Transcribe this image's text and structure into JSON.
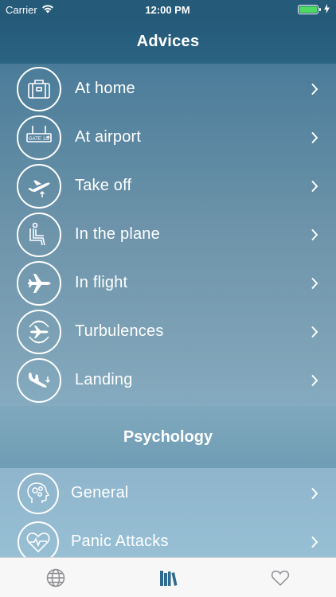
{
  "status_bar": {
    "carrier": "Carrier",
    "time": "12:00 PM",
    "battery_level": 1.0
  },
  "nav": {
    "title": "Advices"
  },
  "advices": [
    {
      "label": "At home",
      "icon": "suitcase-icon"
    },
    {
      "label": "At airport",
      "icon": "gate-sign-icon",
      "icon_text": "GATE 12"
    },
    {
      "label": "Take off",
      "icon": "takeoff-icon"
    },
    {
      "label": "In the plane",
      "icon": "seat-icon"
    },
    {
      "label": "In flight",
      "icon": "airplane-icon"
    },
    {
      "label": "Turbulences",
      "icon": "turbulence-icon"
    },
    {
      "label": "Landing",
      "icon": "landing-icon"
    }
  ],
  "psychology": {
    "title": "Psychology",
    "items": [
      {
        "label": "General",
        "icon": "brain-gears-icon"
      },
      {
        "label": "Panic Attacks",
        "icon": "heart-pulse-icon"
      }
    ]
  },
  "tab_bar": {
    "tabs": [
      {
        "icon": "globe-icon",
        "active": false
      },
      {
        "icon": "library-icon",
        "active": true
      },
      {
        "icon": "heart-icon",
        "active": false
      }
    ]
  },
  "colors": {
    "header": "#255a78",
    "tab_active": "#2f6b8f",
    "tab_inactive": "#8e8e93"
  }
}
